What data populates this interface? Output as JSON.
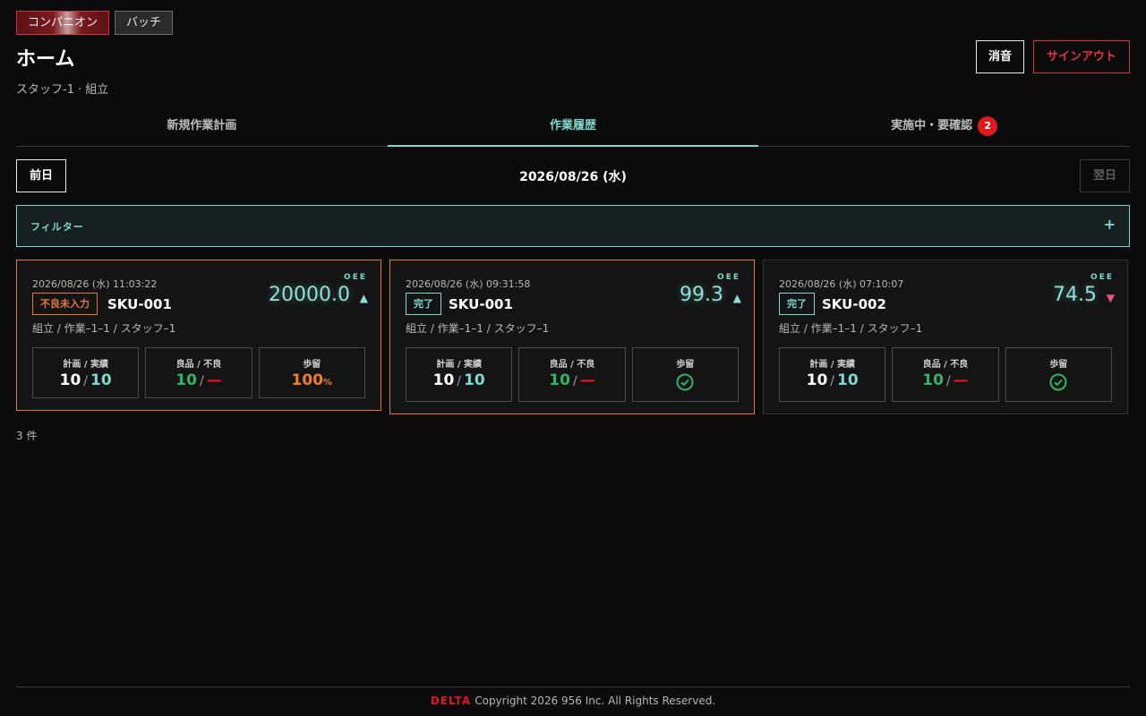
{
  "mode_tabs": [
    "コンパニオン",
    "バッチ"
  ],
  "page_title": "ホーム",
  "subtitle": "スタッフ-1 · 組立",
  "actions": {
    "mute": "消音",
    "signout": "サインアウト"
  },
  "main_tabs": [
    {
      "label": "新規作業計画"
    },
    {
      "label": "作業履歴"
    },
    {
      "label": "実施中・要確認",
      "badge": "2"
    }
  ],
  "date_nav": {
    "prev": "前日",
    "date": "2026/08/26 (水)",
    "next": "翌日"
  },
  "filter": {
    "label": "フィルター",
    "toggle": "+"
  },
  "cards": [
    {
      "timestamp": "2026/08/26 (水) 11:03:22",
      "status": "不良未入力",
      "sku": "SKU-001",
      "oee_label": "OEE",
      "oee": "20000.0",
      "oee_trend": "▲",
      "path": "組立 / 作業–1–1 / スタッフ–1",
      "plan_label": "計画 / 実績",
      "plan": "10",
      "actual": "10",
      "quality_label": "良品 / 不良",
      "good": "10",
      "bad": "—",
      "yield_label": "歩留",
      "yield": "100",
      "yield_unit": "%"
    },
    {
      "timestamp": "2026/08/26 (水) 09:31:58",
      "status": "完了",
      "sku": "SKU-001",
      "oee_label": "OEE",
      "oee": "99.3",
      "oee_trend": "▲",
      "path": "組立 / 作業–1–1 / スタッフ–1",
      "plan_label": "計画 / 実績",
      "plan": "10",
      "actual": "10",
      "quality_label": "良品 / 不良",
      "good": "10",
      "bad": "—",
      "yield_label": "歩留"
    },
    {
      "timestamp": "2026/08/26 (水) 07:10:07",
      "status": "完了",
      "sku": "SKU-002",
      "oee_label": "OEE",
      "oee": "74.5",
      "oee_trend": "▼",
      "path": "組立 / 作業–1–1 / スタッフ–1",
      "plan_label": "計画 / 実績",
      "plan": "10",
      "actual": "10",
      "quality_label": "良品 / 不良",
      "good": "10",
      "bad": "—",
      "yield_label": "歩留"
    }
  ],
  "count": "3 件",
  "footer": {
    "brand": "DELTA",
    "text": "Copyright 2026 956 Inc. All Rights Reserved."
  },
  "colors": {
    "accent": "#7fd8cc",
    "danger": "#e0191f",
    "warning": "#e2793a",
    "good": "#2fb46a"
  },
  "icons": {
    "yield_ok": "check-circle-icon",
    "trend_up": "triangle-up-icon",
    "trend_down": "triangle-down-icon"
  }
}
